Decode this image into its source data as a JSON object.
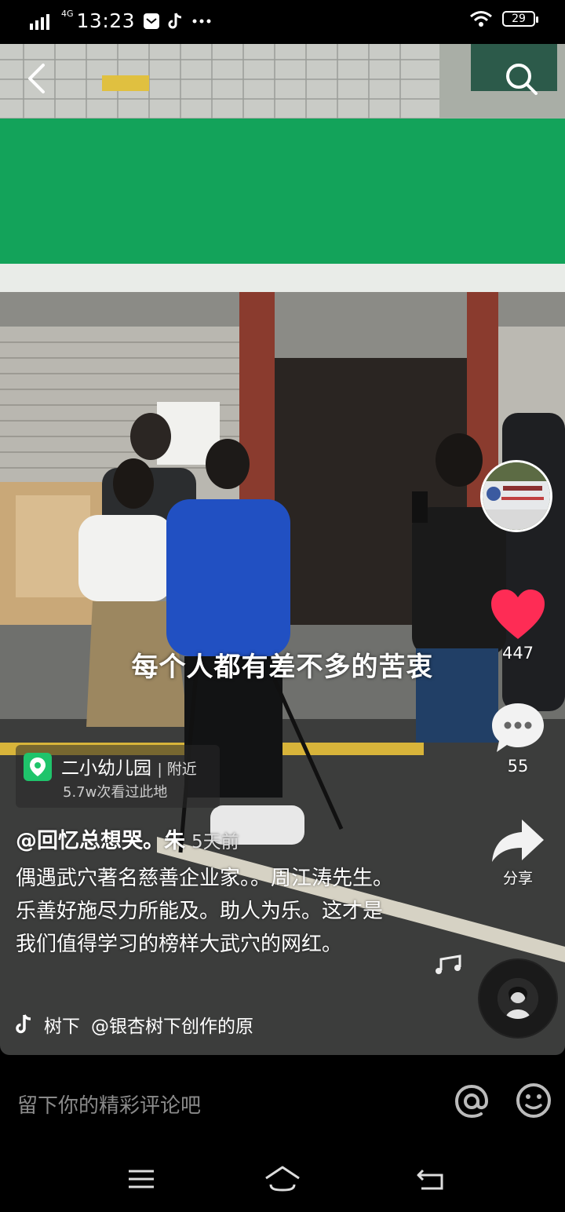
{
  "status_bar": {
    "network": "4G",
    "time": "13:23",
    "battery": "29",
    "icons": [
      "mail-icon",
      "tiktok-icon",
      "more-dots-icon",
      "wifi-icon",
      "battery-icon"
    ]
  },
  "video": {
    "subtitle": "每个人都有差不多的苦衷",
    "top_icons": [
      "back-icon",
      "search-icon"
    ]
  },
  "actions": {
    "likes": "447",
    "comments": "55",
    "share_label": "分享",
    "like_color": "#fe2c55"
  },
  "location": {
    "name": "二小幼儿园",
    "nearby": "附近",
    "views": "5.7w次看过此地"
  },
  "post": {
    "author": "@回忆总想哭。朱",
    "time": "5天前",
    "description": "偶遇武穴著名慈善企业家。。周江涛先生。乐善好施尽力所能及。助人为乐。这才是我们值得学习的榜样大武穴的网红。",
    "music_prefix": "树下",
    "music_text": "@银杏树下创作的原"
  },
  "comment_bar": {
    "placeholder": "留下你的精彩评论吧"
  },
  "nav": {
    "icons": [
      "menu-icon",
      "home-icon",
      "back-nav-icon"
    ]
  }
}
